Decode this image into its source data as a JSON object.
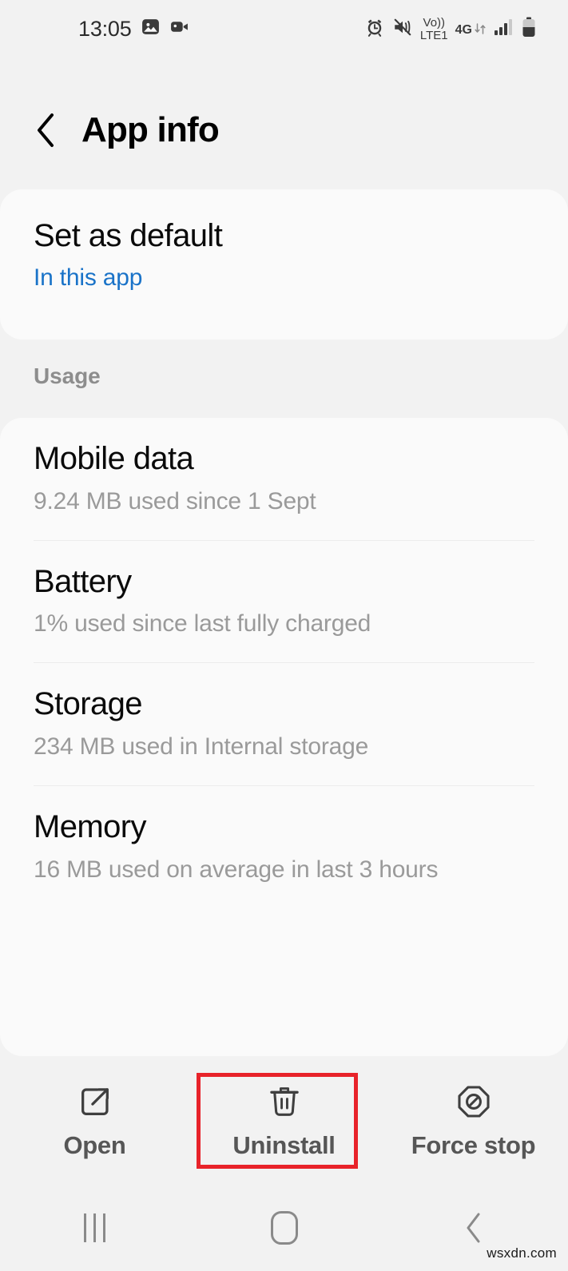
{
  "status_bar": {
    "time": "13:05",
    "left_icons": [
      "image-icon",
      "video-camera-icon"
    ],
    "right_icons": [
      "alarm-icon",
      "vibrate-icon",
      "volte-icon",
      "network-4g-icon",
      "signal-bars-icon",
      "battery-icon"
    ],
    "volte_line1": "Vo))",
    "volte_line2": "LTE1",
    "network_type": "4G"
  },
  "header": {
    "back_icon": "chevron-left-icon",
    "title": "App info"
  },
  "default_card": {
    "title": "Set as default",
    "subtitle": "In this app",
    "accent_color": "#1a73c8"
  },
  "usage": {
    "section_label": "Usage",
    "rows": [
      {
        "title": "Mobile data",
        "subtitle": "9.24 MB used since 1 Sept"
      },
      {
        "title": "Battery",
        "subtitle": "1% used since last fully charged"
      },
      {
        "title": "Storage",
        "subtitle": "234 MB used in Internal storage"
      },
      {
        "title": "Memory",
        "subtitle": "16 MB used on average in last 3 hours"
      }
    ]
  },
  "actions": [
    {
      "label": "Open",
      "icon": "external-link-icon"
    },
    {
      "label": "Uninstall",
      "icon": "trash-icon"
    },
    {
      "label": "Force stop",
      "icon": "block-octagon-icon"
    }
  ],
  "highlight": {
    "target": "Uninstall",
    "color": "#e8232a"
  },
  "nav_bar": {
    "recents": "recents-icon",
    "home": "home-icon",
    "back": "back-icon"
  },
  "watermark": "wsxdn.com"
}
